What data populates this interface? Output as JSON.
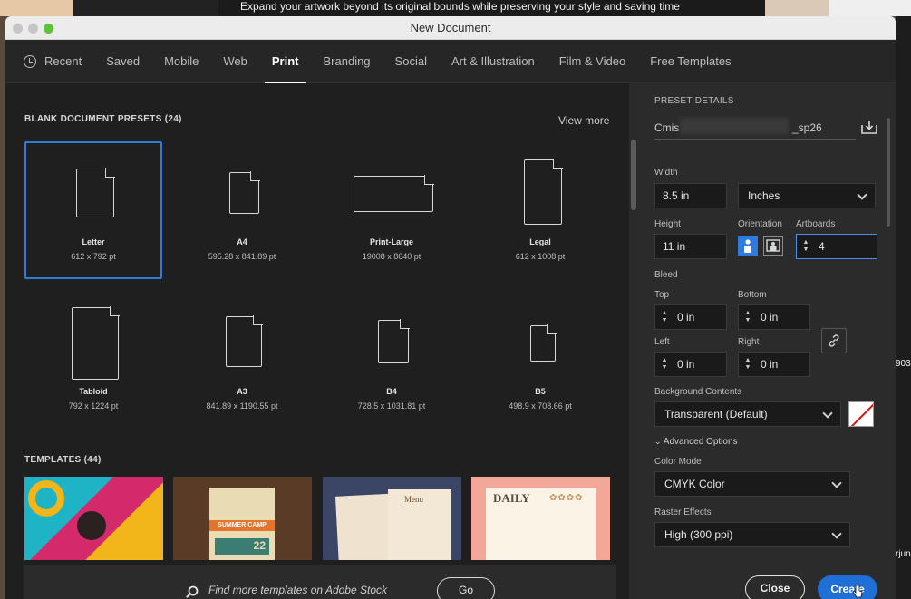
{
  "background": {
    "banner_text": "Expand your artwork beyond its original bounds while preserving your style and saving time",
    "right_texts": [
      "903",
      "rjun"
    ]
  },
  "window": {
    "title": "New Document"
  },
  "tabs": [
    {
      "label": "Recent"
    },
    {
      "label": "Saved"
    },
    {
      "label": "Mobile"
    },
    {
      "label": "Web"
    },
    {
      "label": "Print",
      "active": true
    },
    {
      "label": "Branding"
    },
    {
      "label": "Social"
    },
    {
      "label": "Art & Illustration"
    },
    {
      "label": "Film & Video"
    },
    {
      "label": "Free Templates"
    }
  ],
  "presets": {
    "title": "BLANK DOCUMENT PRESETS",
    "count": "(24)",
    "view_more": "View more",
    "items": [
      {
        "name": "Letter",
        "dim": "612 x 792 pt"
      },
      {
        "name": "A4",
        "dim": "595.28 x 841.89 pt"
      },
      {
        "name": "Print-Large",
        "dim": "19008 x 8640 pt"
      },
      {
        "name": "Legal",
        "dim": "612 x 1008 pt"
      },
      {
        "name": "Tabloid",
        "dim": "792 x 1224 pt"
      },
      {
        "name": "A3",
        "dim": "841.89 x 1190.55 pt"
      },
      {
        "name": "B4",
        "dim": "728.5 x 1031.81 pt"
      },
      {
        "name": "B5",
        "dim": "498.9 x 708.66 pt"
      }
    ]
  },
  "templates": {
    "title": "TEMPLATES",
    "count": "(44)",
    "thumb_texts": {
      "summer_camp": "SUMMER CAMP",
      "number": "22",
      "menu": "Menu",
      "daily": "DAILY"
    }
  },
  "stock": {
    "placeholder": "Find more templates on Adobe Stock",
    "go_label": "Go"
  },
  "details": {
    "heading": "PRESET DETAILS",
    "name_prefix": "Cmis",
    "name_suffix": "_sp26",
    "width_label": "Width",
    "width_value": "8.5 in",
    "units_value": "Inches",
    "height_label": "Height",
    "height_value": "11 in",
    "orientation_label": "Orientation",
    "artboards_label": "Artboards",
    "artboards_value": "4",
    "bleed_label": "Bleed",
    "top_label": "Top",
    "top_value": "0 in",
    "bottom_label": "Bottom",
    "bottom_value": "0 in",
    "left_label": "Left",
    "left_value": "0 in",
    "right_label": "Right",
    "right_value": "0 in",
    "bg_label": "Background Contents",
    "bg_value": "Transparent (Default)",
    "advanced_label": "Advanced Options",
    "color_mode_label": "Color Mode",
    "color_mode_value": "CMYK Color",
    "raster_label": "Raster Effects",
    "raster_value": "High (300 ppi)",
    "close_label": "Close",
    "create_label": "Create"
  },
  "colors": {
    "accent": "#2e7cd6",
    "create_button": "#1f6fd6",
    "panel_bg": "#2b2b2b",
    "main_bg": "#1f1f1f"
  }
}
